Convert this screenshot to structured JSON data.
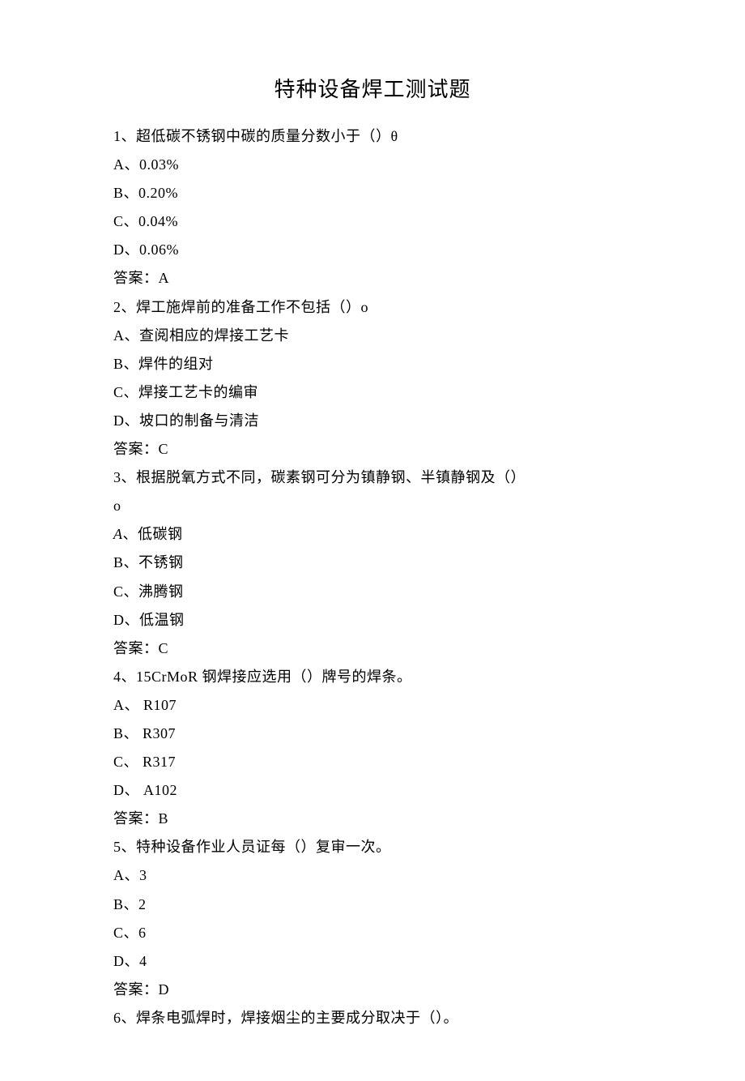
{
  "title": "特种设备焊工测试题",
  "questions": [
    {
      "stem": "1、超低碳不锈钢中碳的质量分数小于（）θ",
      "options": [
        "A、0.03%",
        "B、0.20%",
        "C、0.04%",
        "D、0.06%"
      ],
      "answer": "答案：A"
    },
    {
      "stem": "2、焊工施焊前的准备工作不包括（）o",
      "options": [
        "A、查阅相应的焊接工艺卡",
        "B、焊件的组对",
        "C、焊接工艺卡的编审",
        "D、坡口的制备与清洁"
      ],
      "answer": "答案：C"
    },
    {
      "stem": "3、根据脱氧方式不同，碳素钢可分为镇静钢、半镇静钢及（）",
      "stem_cont": "o",
      "options_special": [
        {
          "label_italic": "A",
          "rest": "、低碳钢"
        },
        {
          "text": "B、不锈钢"
        },
        {
          "text": "C、沸腾钢"
        },
        {
          "text": "D、低温钢"
        }
      ],
      "answer": "答案：C"
    },
    {
      "stem": "4、15CrMoR 钢焊接应选用（）牌号的焊条。",
      "options": [
        "A、 R107",
        "B、 R307",
        "C、 R317",
        "D、 A102"
      ],
      "answer": "答案：B"
    },
    {
      "stem": "5、特种设备作业人员证每（）复审一次。",
      "options": [
        "A、3",
        "B、2",
        "C、6",
        "D、4"
      ],
      "answer": "答案：D"
    },
    {
      "stem": "6、焊条电弧焊时，焊接烟尘的主要成分取决于（）。"
    }
  ]
}
